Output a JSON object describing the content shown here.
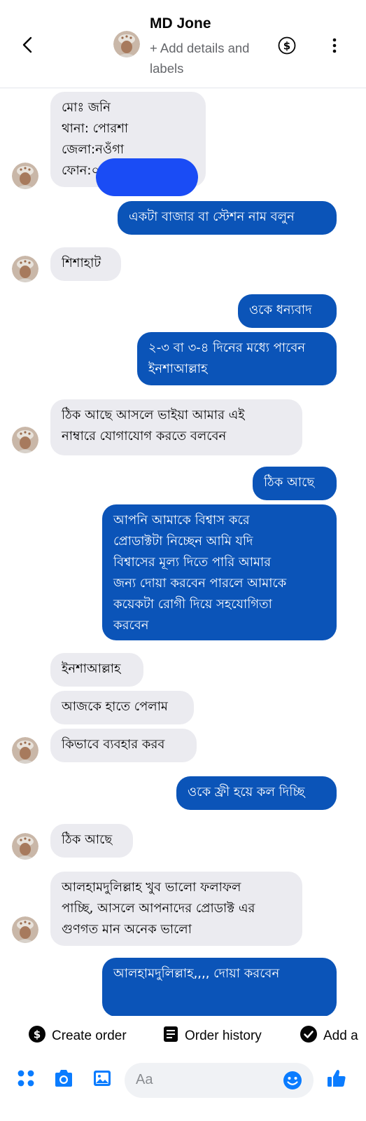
{
  "header": {
    "name": "MD Jone",
    "add_details": "+ Add details and labels"
  },
  "messages": [
    {
      "dir": "in",
      "text": "মোঃ জনি\nথানা: পোরশা\nজেলা:নওঁগা\nফোন:০১"
    },
    {
      "dir": "out",
      "text": "একটা বাজার বা স্টেশন নাম বলুন"
    },
    {
      "dir": "in",
      "text": "শিশাহাট"
    },
    {
      "dir": "out",
      "text": "ওকে ধন্যবাদ"
    },
    {
      "dir": "out",
      "text": "২-৩ বা ৩-৪ দিনের মধ্যে পাবেন\nইনশাআল্লাহ"
    },
    {
      "dir": "in",
      "text": "ঠিক আছে আসলে ভাইয়া আমার এই\nনাম্বারে যোগাযোগ করতে বলবেন"
    },
    {
      "dir": "out",
      "text": "ঠিক আছে"
    },
    {
      "dir": "out",
      "text": "আপনি আমাকে বিশ্বাস করে\nপ্রোডাক্টটা নিচ্ছেন আমি যদি\nবিশ্বাসের মূল্য দিতে পারি আমার\nজন্য দোয়া করবেন পারলে আমাকে\nকয়েকটা রোগী দিয়ে সহযোগিতা\nকরবেন"
    },
    {
      "dir": "in",
      "text": "ইনশাআল্লাহ"
    },
    {
      "dir": "in",
      "text": "আজকে হাতে পেলাম"
    },
    {
      "dir": "in",
      "text": "কিভাবে ব্যবহার করব"
    },
    {
      "dir": "out",
      "text": "ওকে ফ্রী হয়ে কল দিচ্ছি"
    },
    {
      "dir": "in",
      "text": "ঠিক আছে"
    },
    {
      "dir": "in",
      "text": "আলহামদুলিল্লাহ খুব ভালো ফলাফল\nপাচ্ছি, আসলে আপনাদের প্রোডাক্ট এর\nগুণগত মান অনেক ভালো"
    },
    {
      "dir": "out",
      "text": "আলহামদুলিল্লাহ,,,, দোয়া করবেন"
    }
  ],
  "actions": {
    "create_order": "Create order",
    "order_history": "Order history",
    "add": "Add a"
  },
  "composer": {
    "placeholder": "Aa"
  },
  "colors": {
    "outgoing": "#0b54b8",
    "incoming": "#ebebf0",
    "accent": "#0a7cff"
  }
}
